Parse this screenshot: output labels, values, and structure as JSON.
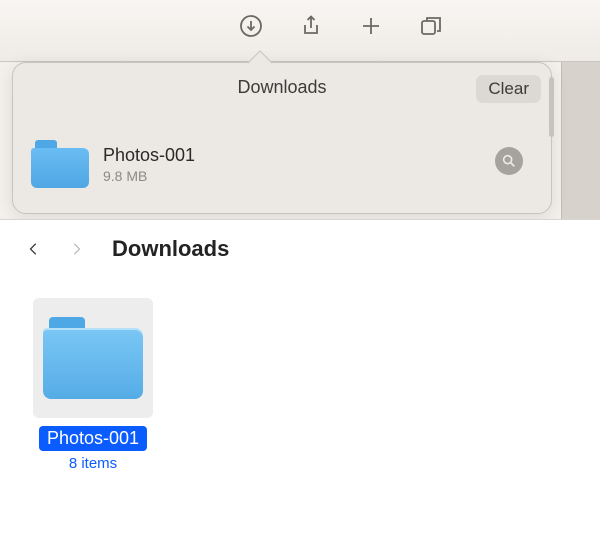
{
  "toolbar": {
    "icons": [
      "downloads-icon",
      "share-icon",
      "plus-icon",
      "tabs-icon"
    ]
  },
  "popover": {
    "title": "Downloads",
    "clear_label": "Clear",
    "items": [
      {
        "name": "Photos-001",
        "size": "9.8 MB"
      }
    ]
  },
  "finder": {
    "location": "Downloads",
    "items": [
      {
        "name": "Photos-001",
        "detail": "8 items",
        "selected": true
      }
    ]
  }
}
